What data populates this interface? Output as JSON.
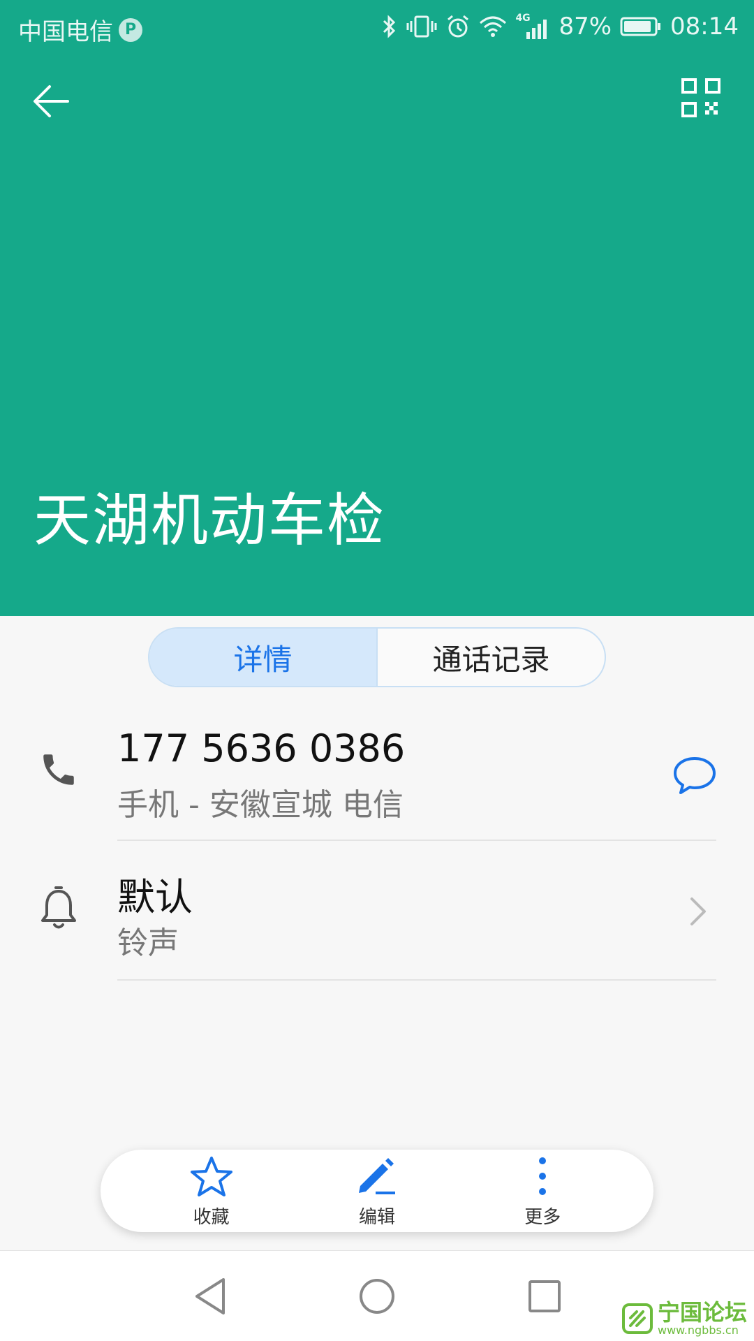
{
  "status_bar": {
    "carrier": "中国电信",
    "carrier_badge": "P",
    "network": "4G",
    "battery": "87%",
    "time": "08:14"
  },
  "header": {
    "contact_name": "天湖机动车检",
    "back_icon": "arrow-left-icon",
    "qr_icon": "qr-code-icon",
    "background_color": "#15a98a"
  },
  "tabs": [
    {
      "label": "详情",
      "active": true
    },
    {
      "label": "通话记录",
      "active": false
    }
  ],
  "phone_row": {
    "number": "177 5636 0386",
    "detail": "手机 - 安徽宣城 电信",
    "icon": "phone-icon",
    "action_icon": "message-icon"
  },
  "ringtone_row": {
    "value": "默认",
    "label": "铃声",
    "icon": "bell-icon"
  },
  "action_bar": {
    "favorite_label": "收藏",
    "edit_label": "编辑",
    "more_label": "更多",
    "accent_color": "#1a73e8"
  },
  "watermark": {
    "name": "宁国论坛",
    "url": "www.ngbbs.cn"
  }
}
